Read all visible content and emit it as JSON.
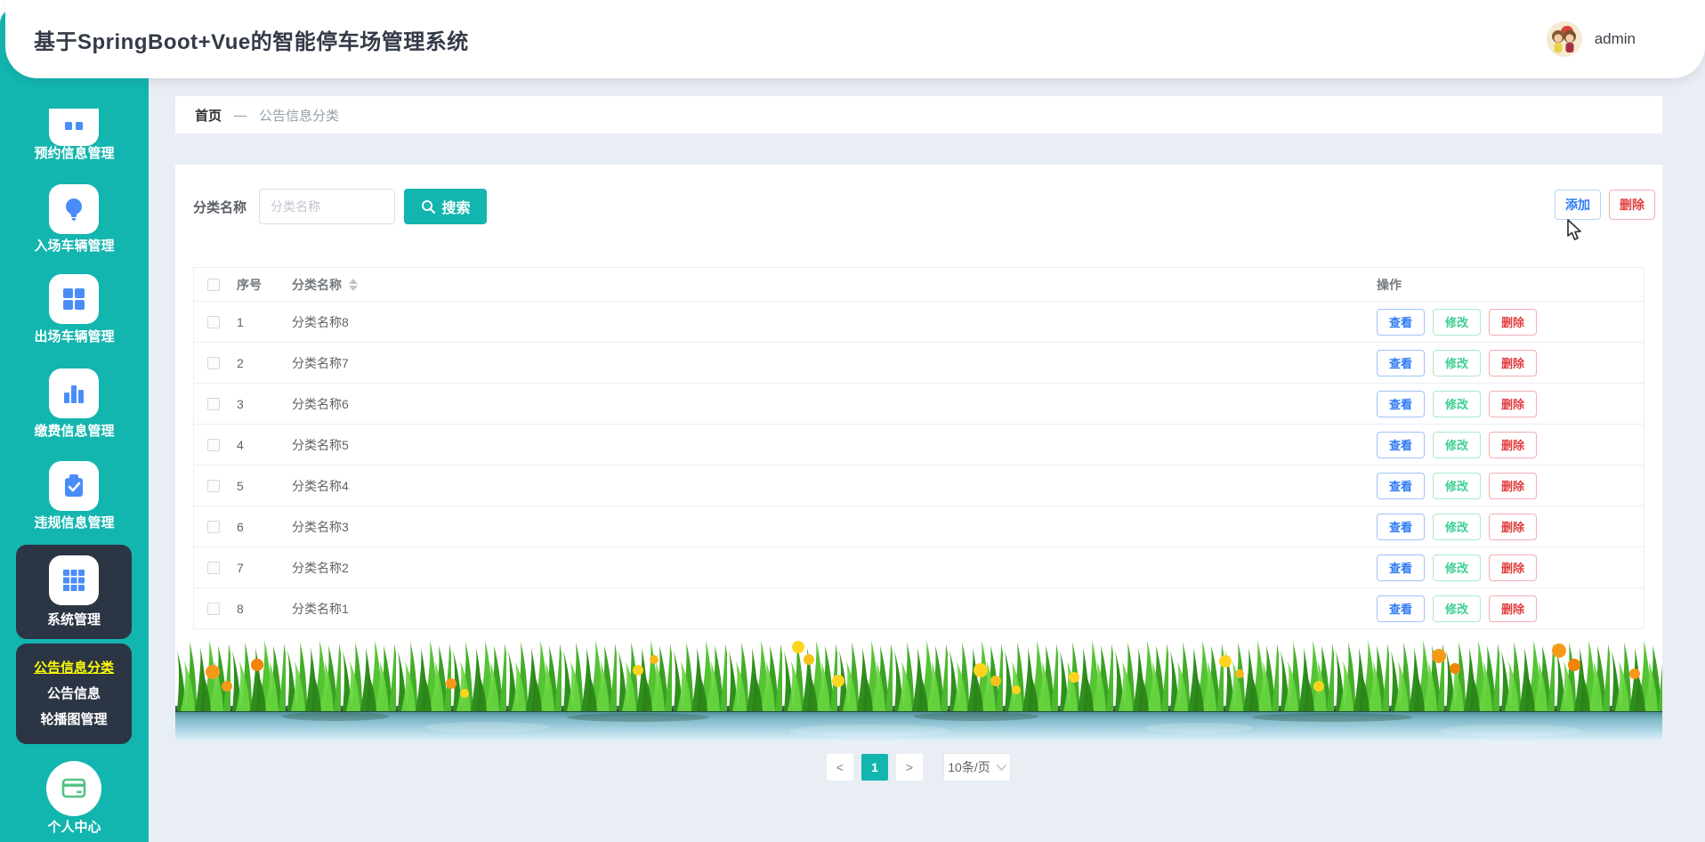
{
  "app": {
    "title": "基于SpringBoot+Vue的智能停车场管理系统"
  },
  "header": {
    "user": "admin"
  },
  "sidebar": {
    "items": [
      {
        "label": "预约信息管理",
        "icon": "reservation-icon"
      },
      {
        "label": "入场车辆管理",
        "icon": "bulb-icon"
      },
      {
        "label": "出场车辆管理",
        "icon": "grid4-icon"
      },
      {
        "label": "缴费信息管理",
        "icon": "bar-chart-icon"
      },
      {
        "label": "违规信息管理",
        "icon": "clipboard-check-icon"
      },
      {
        "label": "系统管理",
        "icon": "grid9-icon",
        "active": true
      },
      {
        "label": "个人中心",
        "icon": "id-card-icon"
      }
    ],
    "submenu": [
      {
        "label": "公告信息分类",
        "active": true
      },
      {
        "label": "公告信息",
        "active": false
      },
      {
        "label": "轮播图管理",
        "active": false
      }
    ]
  },
  "breadcrumb": {
    "home": "首页",
    "separator": "—",
    "current": "公告信息分类"
  },
  "search": {
    "label": "分类名称",
    "placeholder": "分类名称",
    "button": "搜索"
  },
  "toolbar": {
    "add": "添加",
    "delete": "删除"
  },
  "table": {
    "headers": {
      "no": "序号",
      "name": "分类名称",
      "actions": "操作"
    },
    "actions": {
      "view": "查看",
      "edit": "修改",
      "delete": "删除"
    },
    "rows": [
      {
        "no": "1",
        "name": "分类名称8"
      },
      {
        "no": "2",
        "name": "分类名称7"
      },
      {
        "no": "3",
        "name": "分类名称6"
      },
      {
        "no": "4",
        "name": "分类名称5"
      },
      {
        "no": "5",
        "name": "分类名称4"
      },
      {
        "no": "6",
        "name": "分类名称3"
      },
      {
        "no": "7",
        "name": "分类名称2"
      },
      {
        "no": "8",
        "name": "分类名称1"
      }
    ]
  },
  "pagination": {
    "prev": "<",
    "page": "1",
    "next": ">",
    "size": "10条/页"
  },
  "colors": {
    "teal": "#13b5af",
    "dark": "#2c3543",
    "icon_blue": "#4b8df8",
    "blue": "#2f7bf5",
    "green": "#3fcf93",
    "red": "#e03e3e",
    "yellow": "#fcfc05",
    "page_bg": "#e9edf4"
  }
}
